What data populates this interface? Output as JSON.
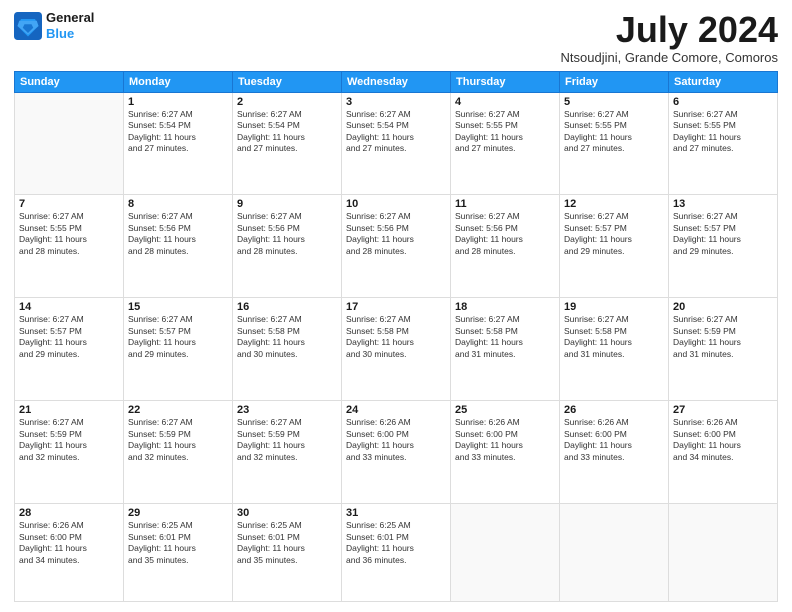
{
  "logo": {
    "line1": "General",
    "line2": "Blue"
  },
  "header": {
    "month": "July 2024",
    "location": "Ntsoudjini, Grande Comore, Comoros"
  },
  "weekdays": [
    "Sunday",
    "Monday",
    "Tuesday",
    "Wednesday",
    "Thursday",
    "Friday",
    "Saturday"
  ],
  "weeks": [
    [
      {
        "day": "",
        "info": ""
      },
      {
        "day": "1",
        "info": "Sunrise: 6:27 AM\nSunset: 5:54 PM\nDaylight: 11 hours\nand 27 minutes."
      },
      {
        "day": "2",
        "info": "Sunrise: 6:27 AM\nSunset: 5:54 PM\nDaylight: 11 hours\nand 27 minutes."
      },
      {
        "day": "3",
        "info": "Sunrise: 6:27 AM\nSunset: 5:54 PM\nDaylight: 11 hours\nand 27 minutes."
      },
      {
        "day": "4",
        "info": "Sunrise: 6:27 AM\nSunset: 5:55 PM\nDaylight: 11 hours\nand 27 minutes."
      },
      {
        "day": "5",
        "info": "Sunrise: 6:27 AM\nSunset: 5:55 PM\nDaylight: 11 hours\nand 27 minutes."
      },
      {
        "day": "6",
        "info": "Sunrise: 6:27 AM\nSunset: 5:55 PM\nDaylight: 11 hours\nand 27 minutes."
      }
    ],
    [
      {
        "day": "7",
        "info": "Sunrise: 6:27 AM\nSunset: 5:55 PM\nDaylight: 11 hours\nand 28 minutes."
      },
      {
        "day": "8",
        "info": "Sunrise: 6:27 AM\nSunset: 5:56 PM\nDaylight: 11 hours\nand 28 minutes."
      },
      {
        "day": "9",
        "info": "Sunrise: 6:27 AM\nSunset: 5:56 PM\nDaylight: 11 hours\nand 28 minutes."
      },
      {
        "day": "10",
        "info": "Sunrise: 6:27 AM\nSunset: 5:56 PM\nDaylight: 11 hours\nand 28 minutes."
      },
      {
        "day": "11",
        "info": "Sunrise: 6:27 AM\nSunset: 5:56 PM\nDaylight: 11 hours\nand 28 minutes."
      },
      {
        "day": "12",
        "info": "Sunrise: 6:27 AM\nSunset: 5:57 PM\nDaylight: 11 hours\nand 29 minutes."
      },
      {
        "day": "13",
        "info": "Sunrise: 6:27 AM\nSunset: 5:57 PM\nDaylight: 11 hours\nand 29 minutes."
      }
    ],
    [
      {
        "day": "14",
        "info": "Sunrise: 6:27 AM\nSunset: 5:57 PM\nDaylight: 11 hours\nand 29 minutes."
      },
      {
        "day": "15",
        "info": "Sunrise: 6:27 AM\nSunset: 5:57 PM\nDaylight: 11 hours\nand 29 minutes."
      },
      {
        "day": "16",
        "info": "Sunrise: 6:27 AM\nSunset: 5:58 PM\nDaylight: 11 hours\nand 30 minutes."
      },
      {
        "day": "17",
        "info": "Sunrise: 6:27 AM\nSunset: 5:58 PM\nDaylight: 11 hours\nand 30 minutes."
      },
      {
        "day": "18",
        "info": "Sunrise: 6:27 AM\nSunset: 5:58 PM\nDaylight: 11 hours\nand 31 minutes."
      },
      {
        "day": "19",
        "info": "Sunrise: 6:27 AM\nSunset: 5:58 PM\nDaylight: 11 hours\nand 31 minutes."
      },
      {
        "day": "20",
        "info": "Sunrise: 6:27 AM\nSunset: 5:59 PM\nDaylight: 11 hours\nand 31 minutes."
      }
    ],
    [
      {
        "day": "21",
        "info": "Sunrise: 6:27 AM\nSunset: 5:59 PM\nDaylight: 11 hours\nand 32 minutes."
      },
      {
        "day": "22",
        "info": "Sunrise: 6:27 AM\nSunset: 5:59 PM\nDaylight: 11 hours\nand 32 minutes."
      },
      {
        "day": "23",
        "info": "Sunrise: 6:27 AM\nSunset: 5:59 PM\nDaylight: 11 hours\nand 32 minutes."
      },
      {
        "day": "24",
        "info": "Sunrise: 6:26 AM\nSunset: 6:00 PM\nDaylight: 11 hours\nand 33 minutes."
      },
      {
        "day": "25",
        "info": "Sunrise: 6:26 AM\nSunset: 6:00 PM\nDaylight: 11 hours\nand 33 minutes."
      },
      {
        "day": "26",
        "info": "Sunrise: 6:26 AM\nSunset: 6:00 PM\nDaylight: 11 hours\nand 33 minutes."
      },
      {
        "day": "27",
        "info": "Sunrise: 6:26 AM\nSunset: 6:00 PM\nDaylight: 11 hours\nand 34 minutes."
      }
    ],
    [
      {
        "day": "28",
        "info": "Sunrise: 6:26 AM\nSunset: 6:00 PM\nDaylight: 11 hours\nand 34 minutes."
      },
      {
        "day": "29",
        "info": "Sunrise: 6:25 AM\nSunset: 6:01 PM\nDaylight: 11 hours\nand 35 minutes."
      },
      {
        "day": "30",
        "info": "Sunrise: 6:25 AM\nSunset: 6:01 PM\nDaylight: 11 hours\nand 35 minutes."
      },
      {
        "day": "31",
        "info": "Sunrise: 6:25 AM\nSunset: 6:01 PM\nDaylight: 11 hours\nand 36 minutes."
      },
      {
        "day": "",
        "info": ""
      },
      {
        "day": "",
        "info": ""
      },
      {
        "day": "",
        "info": ""
      }
    ]
  ]
}
